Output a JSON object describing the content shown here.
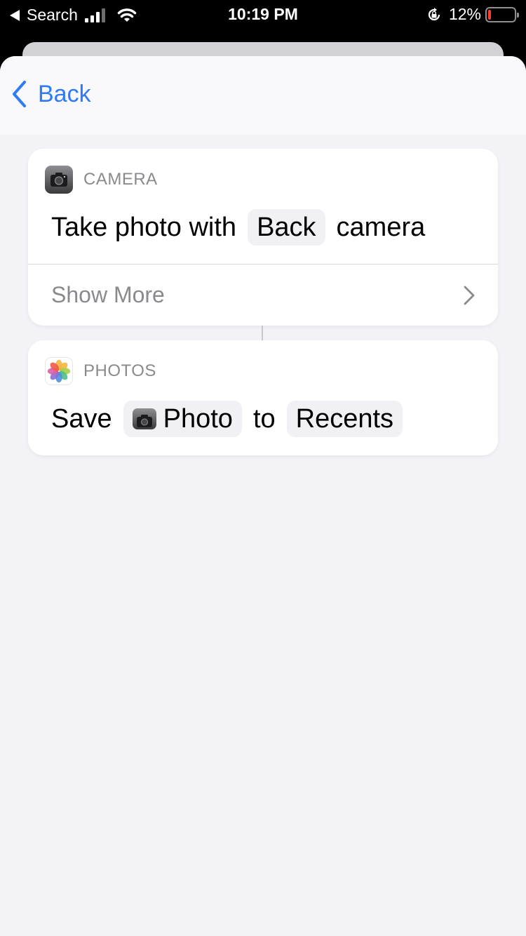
{
  "status_bar": {
    "back_app_label": "Search",
    "time": "10:19 PM",
    "battery_percent": "12%",
    "battery_level": 0.12,
    "battery_color": "#ff3b30"
  },
  "nav": {
    "back_label": "Back",
    "back_icon": "chevron-left-icon",
    "accent": "#2f7bf6"
  },
  "actions": [
    {
      "app": "CAMERA",
      "app_icon": "camera-app-icon",
      "text_before": "Take photo with",
      "token": "Back",
      "text_after": "camera",
      "show_more": "Show More"
    },
    {
      "app": "PHOTOS",
      "app_icon": "photos-app-icon",
      "text_before": "Save",
      "token": "Photo",
      "token_icon": "camera-icon",
      "text_middle": "to",
      "token2": "Recents"
    }
  ]
}
